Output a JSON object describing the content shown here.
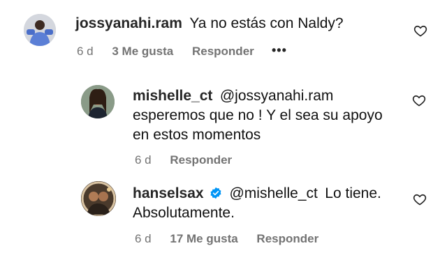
{
  "comments": [
    {
      "username": "jossyanahi.ram",
      "text": "Ya no estás con Naldy?",
      "time": "6 d",
      "likes": "3 Me gusta",
      "reply": "Responder",
      "more": "•••"
    },
    {
      "username": "mishelle_ct",
      "mention": "@jossyanahi.ram",
      "text_line1": "esperemos que no ! Y el sea su apoyo",
      "text_line2": "en estos momentos",
      "time": "6 d",
      "reply": "Responder"
    },
    {
      "username": "hanselsax",
      "verified": true,
      "mention": "@mishelle_ct",
      "text_line1": "Lo tiene.",
      "text_line2": "Absolutamente.",
      "time": "6 d",
      "likes": "17 Me gusta",
      "reply": "Responder"
    }
  ],
  "colors": {
    "mention": "#385185",
    "meta": "#737373",
    "verified": "#0095f6"
  }
}
